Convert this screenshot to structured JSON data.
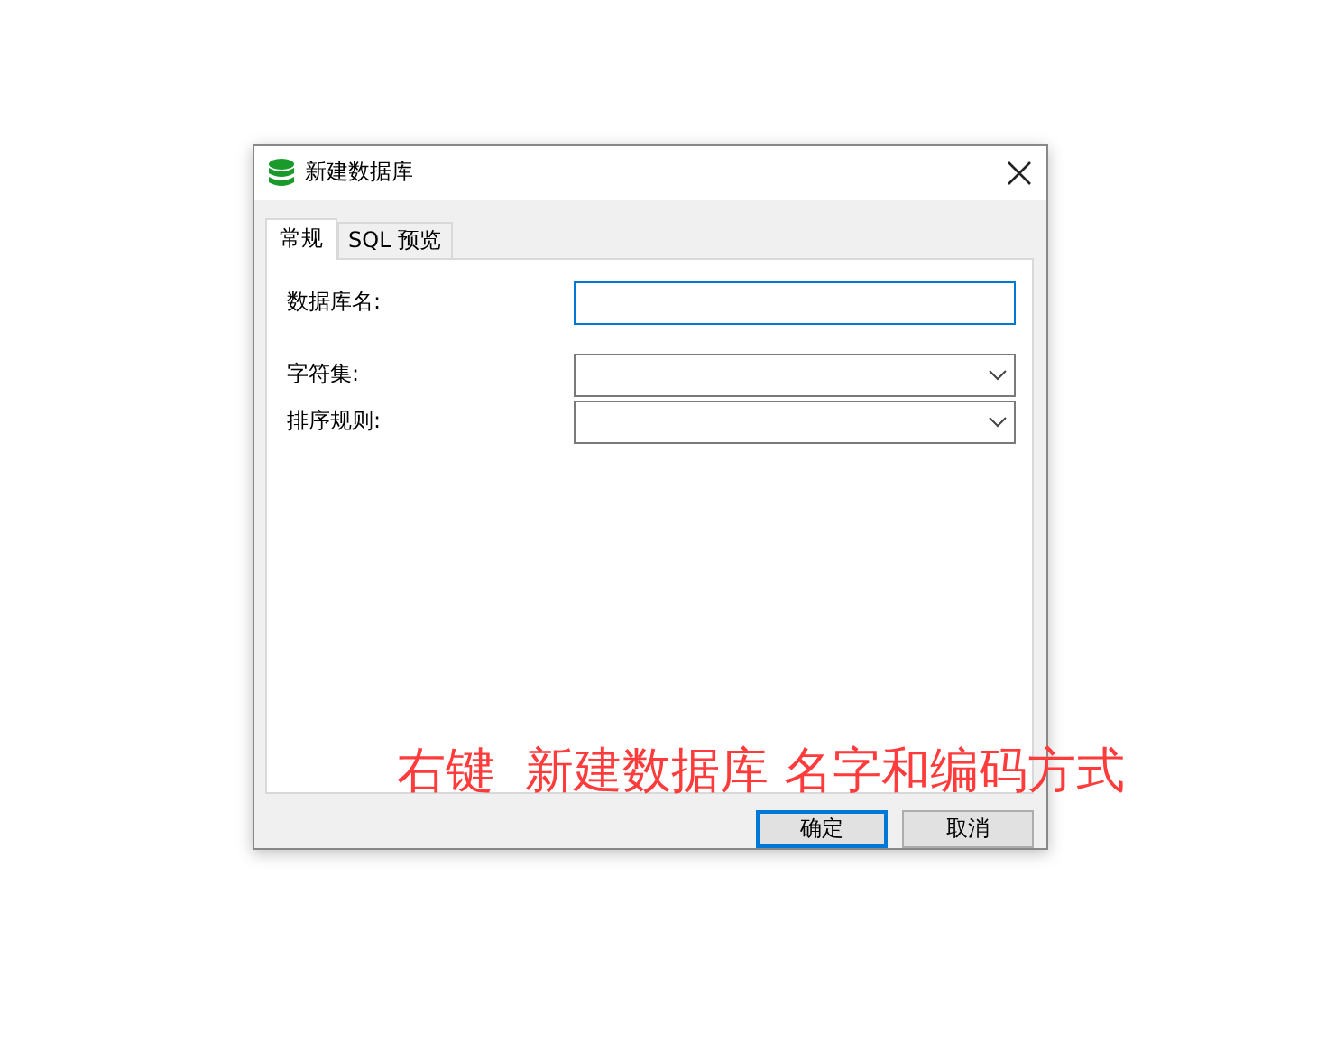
{
  "window": {
    "title": "新建数据库"
  },
  "tabs": [
    {
      "label": "常规",
      "selected": true
    },
    {
      "label": "SQL 预览",
      "selected": false
    }
  ],
  "fields": [
    {
      "label": "数据库名:",
      "kind": "text",
      "focused": true
    },
    {
      "label": "字符集:",
      "kind": "dropdown",
      "focused": false
    },
    {
      "label": "排序规则:",
      "kind": "dropdown",
      "focused": false
    }
  ],
  "buttons": [
    {
      "label": "确定",
      "default": true
    },
    {
      "label": "取消",
      "default": false
    }
  ],
  "annotation": {
    "text": "右键  新建数据库 名字和编码方式"
  }
}
